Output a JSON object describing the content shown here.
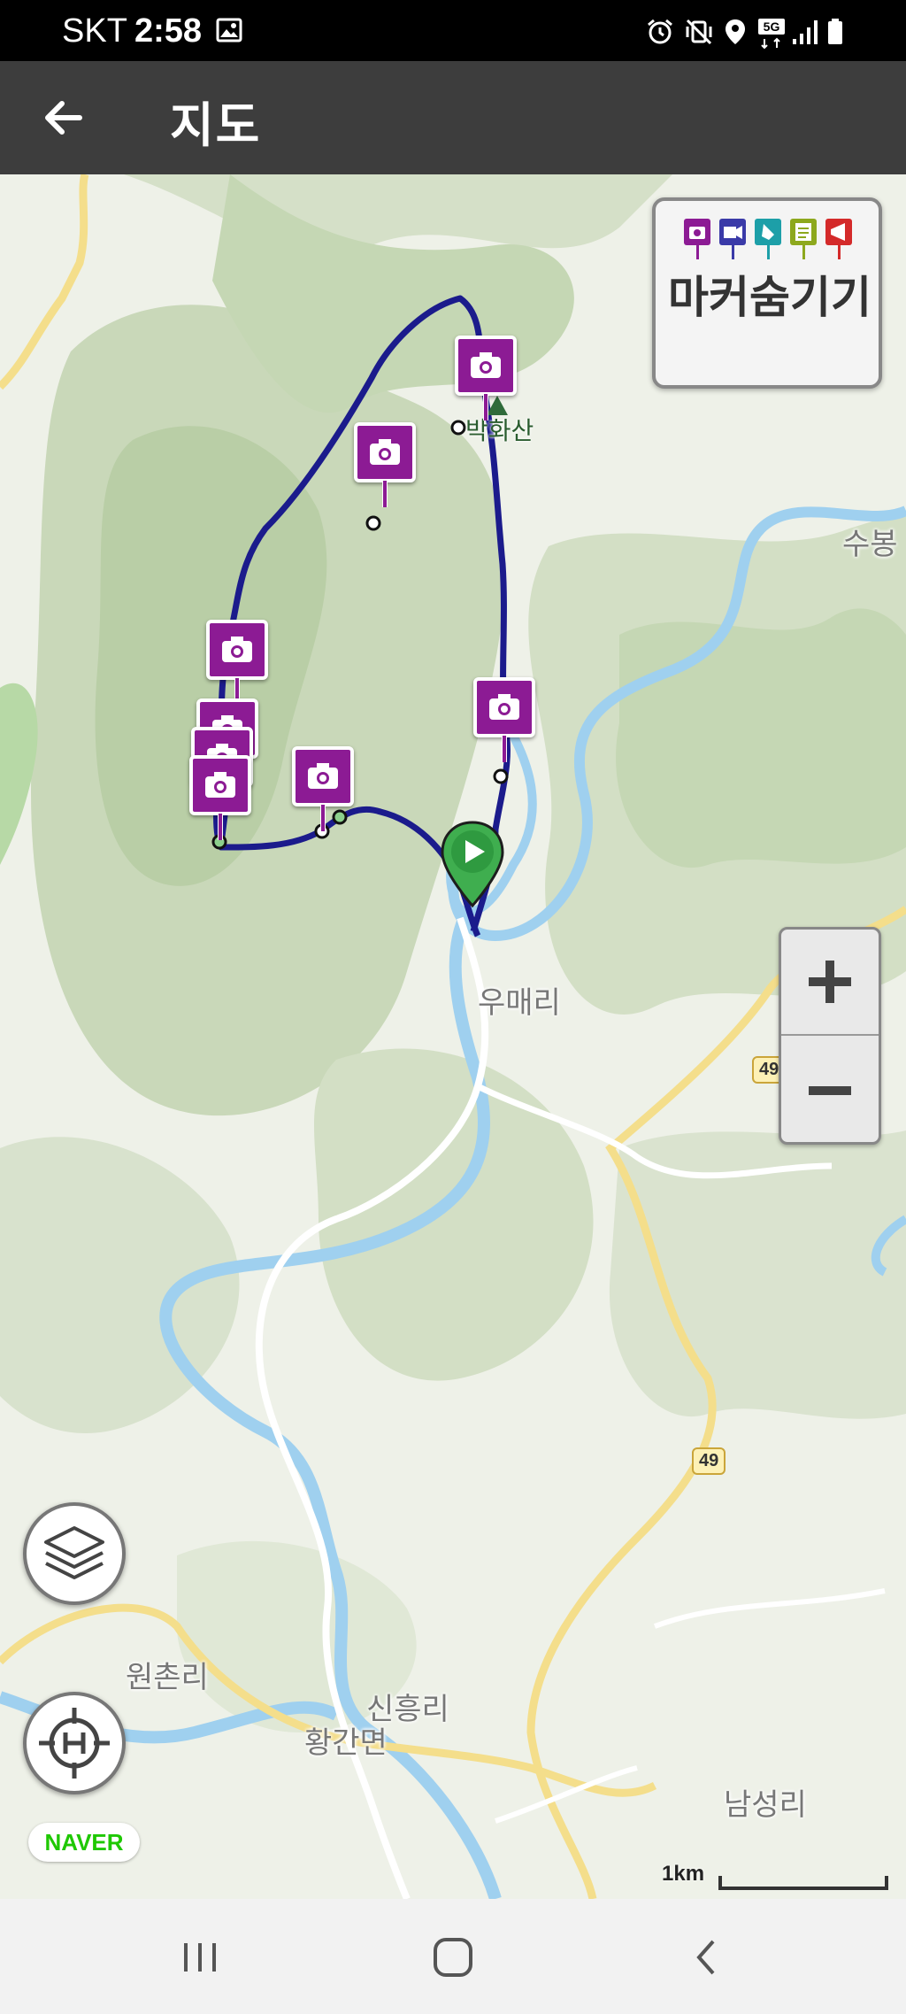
{
  "status_bar": {
    "carrier": "SKT",
    "time": "2:58",
    "icons": [
      "image-icon",
      "alarm-icon",
      "vibrate-mute-icon",
      "location-icon",
      "5g-icon",
      "signal-icon",
      "battery-icon"
    ],
    "network_badge": "5G"
  },
  "app_bar": {
    "back_icon": "arrow-left-icon",
    "title": "지도"
  },
  "map": {
    "hide_markers": {
      "label": "마커숨기기",
      "flag_icons": [
        "camera-flag-icon",
        "video-flag-icon",
        "pin-flag-icon",
        "note-flag-icon",
        "megaphone-flag-icon"
      ],
      "flag_colors": [
        "#8c1b94",
        "#3a3aa8",
        "#1d9fa8",
        "#8da81d",
        "#d42a2a"
      ]
    },
    "peak": "박화산",
    "places": {
      "sububong": "수봉",
      "umaeri": "우매리",
      "wonchonri": "원촌리",
      "sinheungri": "신흥리",
      "hwangganmyeon": "황간면",
      "namseongri": "남성리"
    },
    "route_numbers": [
      "49",
      "49"
    ],
    "photo_markers_count": 8,
    "start_marker": "play-icon",
    "route_color": "#1b1b8c",
    "zoom": {
      "in_icon": "plus-icon",
      "out_icon": "minus-icon"
    },
    "layers_icon": "layers-icon",
    "home_icon": "home-target-icon",
    "naver_logo": "NAVER",
    "scale": "1km"
  },
  "nav_bar": {
    "icons": [
      "recent-apps-icon",
      "home-icon",
      "back-icon"
    ]
  }
}
